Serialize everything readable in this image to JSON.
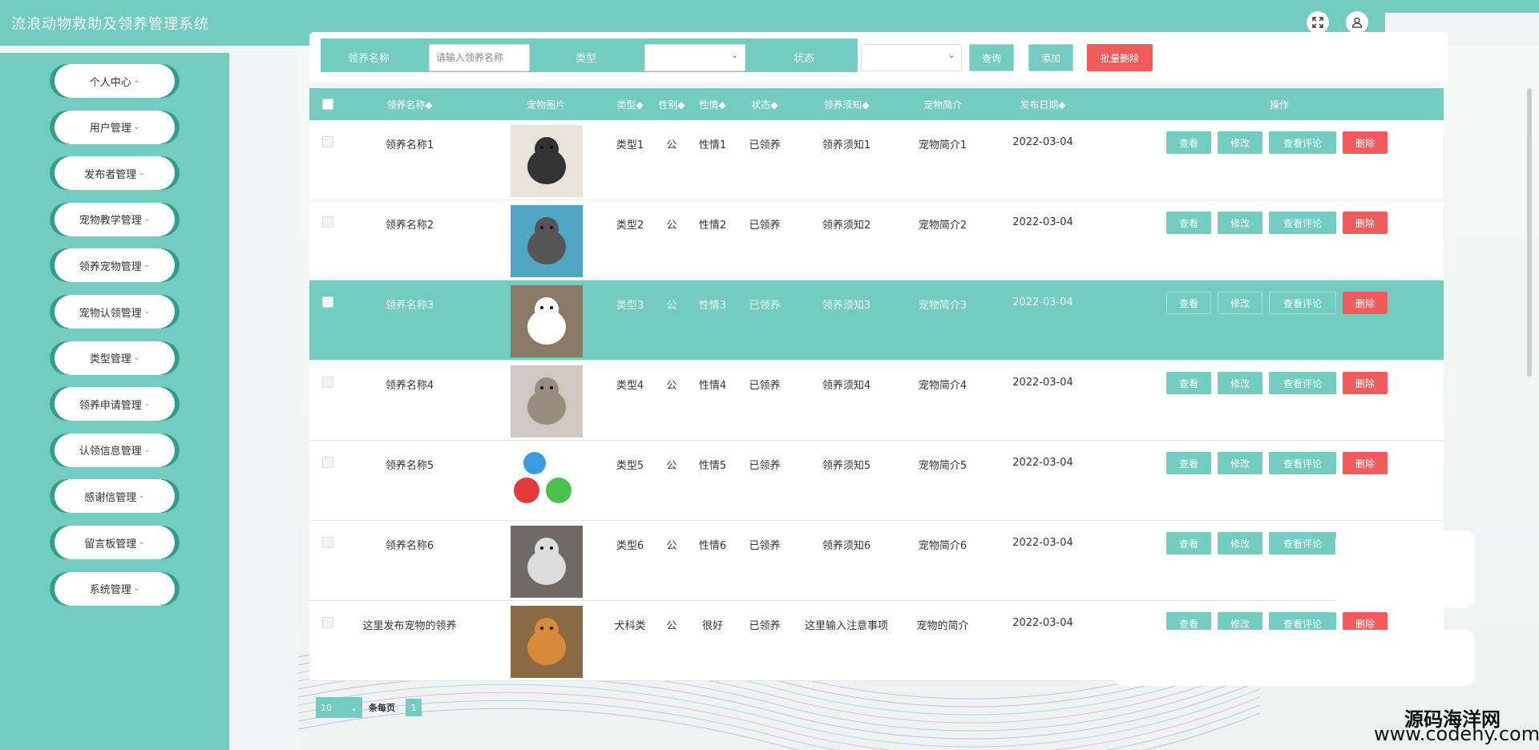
{
  "header": {
    "title": "流浪动物救助及领养管理系统",
    "fullscreen_icon": "expand-icon",
    "user_icon": "user-icon"
  },
  "sidebar": {
    "items": [
      {
        "label": "个人中心"
      },
      {
        "label": "用户管理"
      },
      {
        "label": "发布者管理"
      },
      {
        "label": "宠物教学管理"
      },
      {
        "label": "领养宠物管理"
      },
      {
        "label": "宠物认领管理"
      },
      {
        "label": "类型管理"
      },
      {
        "label": "领养申请管理"
      },
      {
        "label": "认领信息管理"
      },
      {
        "label": "感谢信管理"
      },
      {
        "label": "留言板管理"
      },
      {
        "label": "系统管理"
      }
    ],
    "arrow": "⌄"
  },
  "search": {
    "name_label": "领养名称",
    "name_placeholder": "请输入领养名称",
    "type_label": "类型",
    "status_label": "状态",
    "query_button": "查询",
    "add_button": "添加",
    "batch_delete_button": "批量删除"
  },
  "table": {
    "headers": [
      "领养名称◆",
      "宠物图片",
      "类型◆",
      "性别◆",
      "性情◆",
      "状态◆",
      "领养须知◆",
      "宠物简介",
      "发布日期◆",
      "操作"
    ],
    "rows": [
      {
        "name": "领养名称1",
        "type": "类型1",
        "gender": "公",
        "temper": "性情1",
        "status": "已领养",
        "notice": "领养须知1",
        "intro": "宠物简介1",
        "date": "2022-03-04"
      },
      {
        "name": "领养名称2",
        "type": "类型2",
        "gender": "公",
        "temper": "性情2",
        "status": "已领养",
        "notice": "领养须知2",
        "intro": "宠物简介2",
        "date": "2022-03-04"
      },
      {
        "name": "领养名称3",
        "type": "类型3",
        "gender": "公",
        "temper": "性情3",
        "status": "已领养",
        "notice": "领养须知3",
        "intro": "宠物简介3",
        "date": "2022-03-04"
      },
      {
        "name": "领养名称4",
        "type": "类型4",
        "gender": "公",
        "temper": "性情4",
        "status": "已领养",
        "notice": "领养须知4",
        "intro": "宠物简介4",
        "date": "2022-03-04"
      },
      {
        "name": "领养名称5",
        "type": "类型5",
        "gender": "公",
        "temper": "性情5",
        "status": "已领养",
        "notice": "领养须知5",
        "intro": "宠物简介5",
        "date": "2022-03-04"
      },
      {
        "name": "领养名称6",
        "type": "类型6",
        "gender": "公",
        "temper": "性情6",
        "status": "已领养",
        "notice": "领养须知6",
        "intro": "宠物简介6",
        "date": "2022-03-04"
      },
      {
        "name": "这里发布宠物的领养",
        "type": "犬科类",
        "gender": "公",
        "temper": "很好",
        "status": "已领养",
        "notice": "这里输入注意事项",
        "intro": "宠物的简介",
        "date": "2022-03-04"
      }
    ],
    "actions": {
      "view": "查看",
      "edit": "修改",
      "comments": "查看评论",
      "delete": "删除"
    }
  },
  "pager": {
    "page_size": "10",
    "per_page_label": "条每页",
    "current_page": "1"
  },
  "watermark": {
    "cn": "源码海洋网",
    "url": "www.codehy.com"
  },
  "colors": {
    "accent": "#74cbbf",
    "danger": "#f05b5b",
    "dark_accent": "#2f9f8c"
  }
}
